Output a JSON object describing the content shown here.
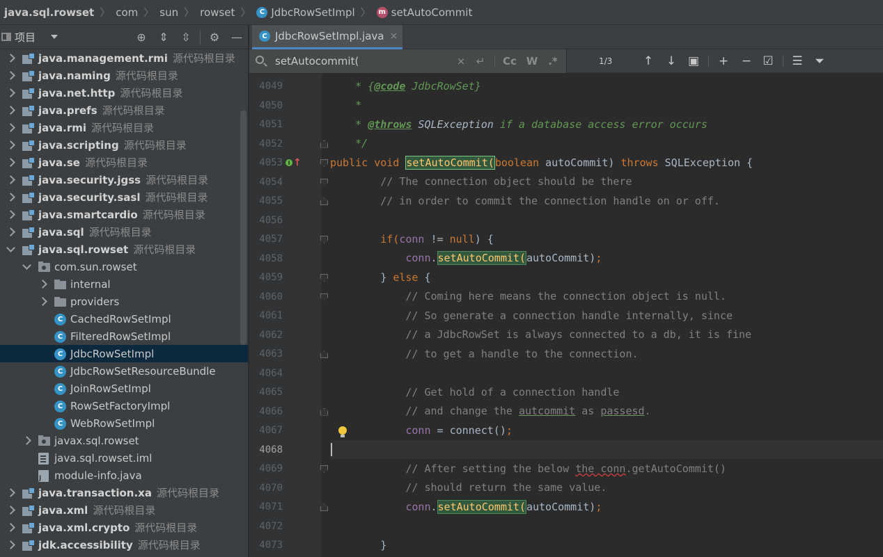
{
  "breadcrumb": {
    "items": [
      {
        "label": "java.sql.rowset",
        "type": "module"
      },
      {
        "label": "com",
        "type": "package"
      },
      {
        "label": "sun",
        "type": "package"
      },
      {
        "label": "rowset",
        "type": "package"
      },
      {
        "label": "JdbcRowSetImpl",
        "type": "class",
        "icon_letter": "C"
      },
      {
        "label": "setAutoCommit",
        "type": "method",
        "icon_letter": "m"
      }
    ]
  },
  "project_panel": {
    "title": "项目",
    "tools": [
      "locate-icon",
      "expand-all-icon",
      "collapse-all-icon",
      "gear-icon",
      "hide-icon"
    ],
    "tree": [
      {
        "label": "java.management.rmi",
        "meta": "源代码根目录",
        "type": "module",
        "expanded": false,
        "depth": 0
      },
      {
        "label": "java.naming",
        "meta": "源代码根目录",
        "type": "module",
        "expanded": false,
        "depth": 0
      },
      {
        "label": "java.net.http",
        "meta": "源代码根目录",
        "type": "module",
        "expanded": false,
        "depth": 0
      },
      {
        "label": "java.prefs",
        "meta": "源代码根目录",
        "type": "module",
        "expanded": false,
        "depth": 0
      },
      {
        "label": "java.rmi",
        "meta": "源代码根目录",
        "type": "module",
        "expanded": false,
        "depth": 0
      },
      {
        "label": "java.scripting",
        "meta": "源代码根目录",
        "type": "module",
        "expanded": false,
        "depth": 0
      },
      {
        "label": "java.se",
        "meta": "源代码根目录",
        "type": "module",
        "expanded": false,
        "depth": 0
      },
      {
        "label": "java.security.jgss",
        "meta": "源代码根目录",
        "type": "module",
        "expanded": false,
        "depth": 0
      },
      {
        "label": "java.security.sasl",
        "meta": "源代码根目录",
        "type": "module",
        "expanded": false,
        "depth": 0
      },
      {
        "label": "java.smartcardio",
        "meta": "源代码根目录",
        "type": "module",
        "expanded": false,
        "depth": 0
      },
      {
        "label": "java.sql",
        "meta": "源代码根目录",
        "type": "module",
        "expanded": false,
        "depth": 0
      },
      {
        "label": "java.sql.rowset",
        "meta": "源代码根目录",
        "type": "module",
        "expanded": true,
        "depth": 0
      },
      {
        "label": "com.sun.rowset",
        "meta": "",
        "type": "package",
        "expanded": true,
        "depth": 1
      },
      {
        "label": "internal",
        "meta": "",
        "type": "folder",
        "expanded": false,
        "depth": 2
      },
      {
        "label": "providers",
        "meta": "",
        "type": "folder",
        "expanded": false,
        "depth": 2
      },
      {
        "label": "CachedRowSetImpl",
        "meta": "",
        "type": "class",
        "depth": 2
      },
      {
        "label": "FilteredRowSetImpl",
        "meta": "",
        "type": "class",
        "depth": 2
      },
      {
        "label": "JdbcRowSetImpl",
        "meta": "",
        "type": "class",
        "depth": 2,
        "selected": true
      },
      {
        "label": "JdbcRowSetResourceBundle",
        "meta": "",
        "type": "class",
        "depth": 2
      },
      {
        "label": "JoinRowSetImpl",
        "meta": "",
        "type": "class",
        "depth": 2
      },
      {
        "label": "RowSetFactoryImpl",
        "meta": "",
        "type": "class",
        "depth": 2
      },
      {
        "label": "WebRowSetImpl",
        "meta": "",
        "type": "class",
        "depth": 2
      },
      {
        "label": "javax.sql.rowset",
        "meta": "",
        "type": "package",
        "expanded": false,
        "depth": 1
      },
      {
        "label": "java.sql.rowset.iml",
        "meta": "",
        "type": "iml",
        "depth": 1
      },
      {
        "label": "module-info.java",
        "meta": "",
        "type": "javafile",
        "depth": 1
      },
      {
        "label": "java.transaction.xa",
        "meta": "源代码根目录",
        "type": "module",
        "expanded": false,
        "depth": 0
      },
      {
        "label": "java.xml",
        "meta": "源代码根目录",
        "type": "module",
        "expanded": false,
        "depth": 0
      },
      {
        "label": "java.xml.crypto",
        "meta": "源代码根目录",
        "type": "module",
        "expanded": false,
        "depth": 0
      },
      {
        "label": "jdk.accessibility",
        "meta": "源代码根目录",
        "type": "module",
        "expanded": false,
        "depth": 0
      }
    ]
  },
  "tab": {
    "label": "JdbcRowSetImpl.java",
    "icon_letter": "C",
    "close": "×"
  },
  "search": {
    "value": "setAutocommit(",
    "placeholder": "",
    "clear": "×",
    "newline": "↵",
    "match_case": "Cc",
    "words": "W",
    "regex": ".*",
    "match_count": "1/3",
    "tools": [
      "up-arrow-icon",
      "down-arrow-icon",
      "filter-window-icon",
      "add-selection-icon",
      "remove-selection-icon",
      "select-all-icon",
      "multiline-icon",
      "filter-icon"
    ]
  },
  "editor": {
    "current_line": "4068",
    "lines": [
      {
        "num": "4049"
      },
      {
        "num": "4050"
      },
      {
        "num": "4051"
      },
      {
        "num": "4052"
      },
      {
        "num": "4053"
      },
      {
        "num": "4054"
      },
      {
        "num": "4055"
      },
      {
        "num": "4056"
      },
      {
        "num": "4057"
      },
      {
        "num": "4058"
      },
      {
        "num": "4059"
      },
      {
        "num": "4060"
      },
      {
        "num": "4061"
      },
      {
        "num": "4062"
      },
      {
        "num": "4063"
      },
      {
        "num": "4064"
      },
      {
        "num": "4065"
      },
      {
        "num": "4066"
      },
      {
        "num": "4067"
      },
      {
        "num": "4068"
      },
      {
        "num": "4069"
      },
      {
        "num": "4070"
      },
      {
        "num": "4071"
      },
      {
        "num": "4072"
      },
      {
        "num": "4073"
      }
    ],
    "code": {
      "l4049_a": "    * {",
      "l4049_tag": "@code",
      "l4049_b": " JdbcRowSet}",
      "l4050": "    *",
      "l4051_a": "    * ",
      "l4051_tag": "@throws",
      "l4051_b": " SQLException",
      "l4051_c": " if a database access error occurs",
      "l4052": "    */",
      "l4053_kw1": "public void ",
      "l4053_m": "setAutoCommit(",
      "l4053_kw2": "boolean",
      "l4053_p": " autoCommit) ",
      "l4053_kw3": "throws",
      "l4053_e": " SQLException {",
      "l4054": "        // The connection object should be there",
      "l4055": "        // in order to commit the connection handle on or off.",
      "l4057_kw": "        if(",
      "l4057_f": "conn",
      "l4057_b": " != ",
      "l4057_n": "null",
      "l4057_c": ") {",
      "l4058_f": "            conn",
      "l4058_d": ".",
      "l4058_m": "setAutoCommit(",
      "l4058_a": "autoCommit)",
      "l4058_s": ";",
      "l4059_a": "        } ",
      "l4059_kw": "else",
      "l4059_b": " {",
      "l4060": "            // Coming here means the connection object is null.",
      "l4061": "            // So generate a connection handle internally, since",
      "l4062": "            // a JdbcRowSet is always connected to a db, it is fine",
      "l4063": "            // to get a handle to the connection.",
      "l4065": "            // Get hold of a connection handle",
      "l4066_a": "            // and change the ",
      "l4066_u1": "autcommit",
      "l4066_b": " as ",
      "l4066_u2": "passesd",
      "l4066_c": ".",
      "l4067_f": "            conn",
      "l4067_a": " = connect()",
      "l4067_s": ";",
      "l4069_a": "            // After setting the below ",
      "l4069_u": "the conn",
      "l4069_b": ".getAutoCommit()",
      "l4070": "            // should return the same value.",
      "l4071_f": "            conn",
      "l4071_d": ".",
      "l4071_m": "setAutoCommit(",
      "l4071_a": "autoCommit)",
      "l4071_s": ";",
      "l4073": "        }"
    }
  },
  "colors": {
    "keyword": "#cc7832",
    "comment": "#808080",
    "doc": "#629755",
    "field": "#9876aa",
    "method_highlight": "#32593d",
    "selection": "#0d293e",
    "tab_underline": "#4a88c7"
  }
}
